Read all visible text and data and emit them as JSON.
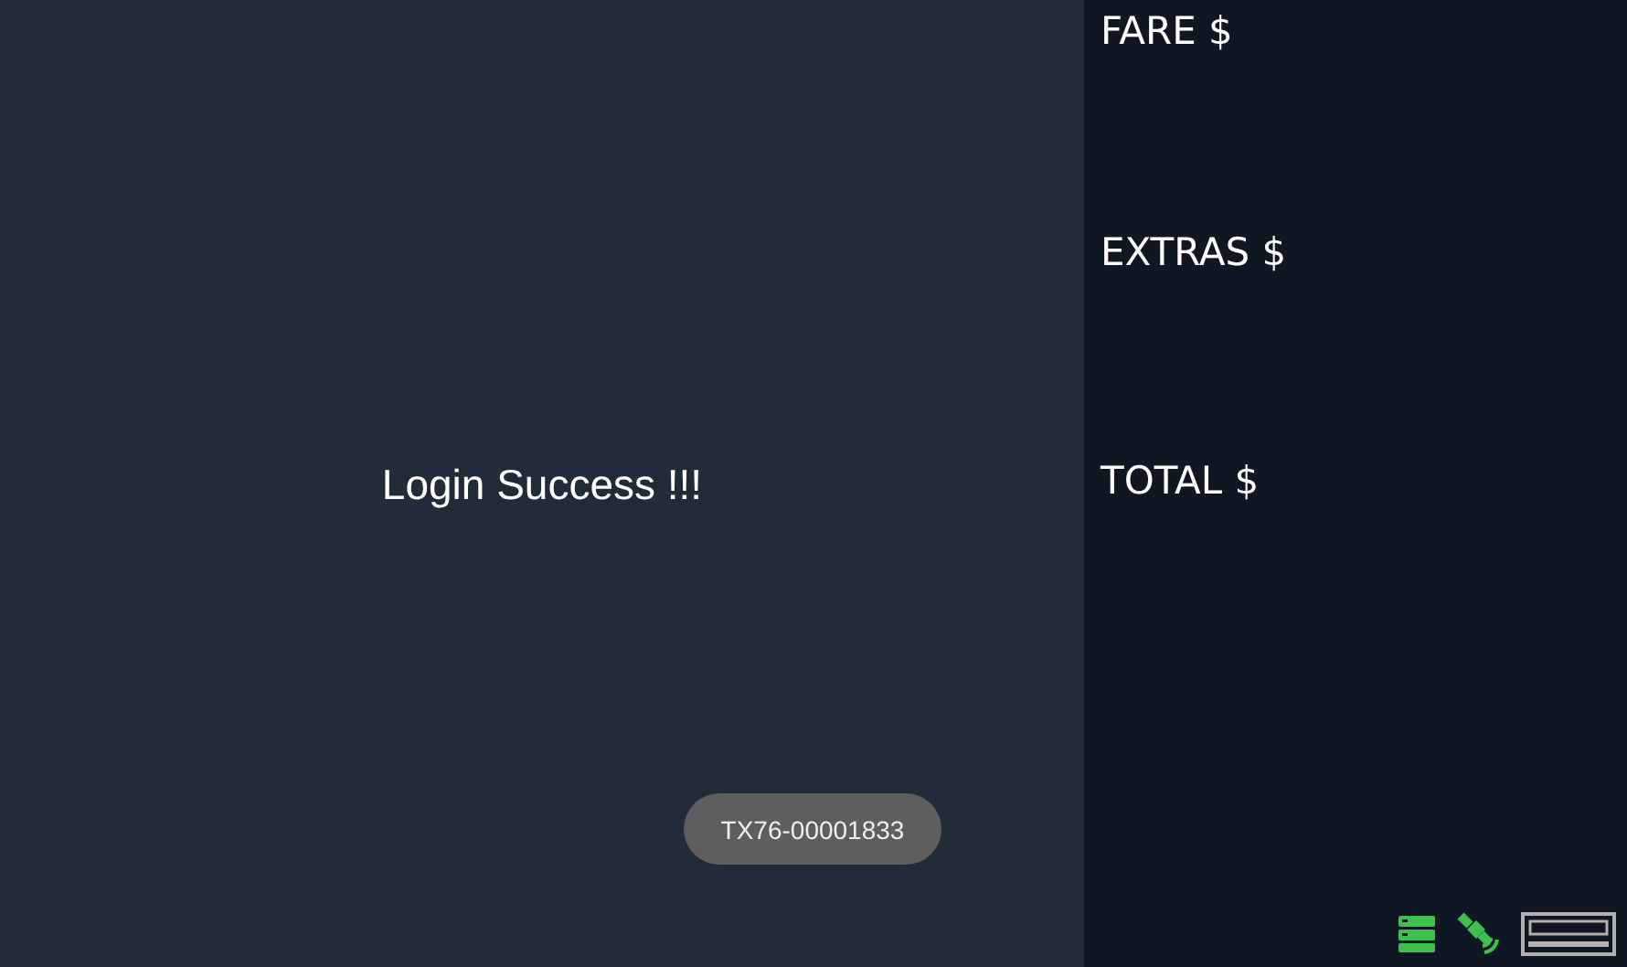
{
  "main": {
    "message": "Login Success !!!"
  },
  "fare_panel": {
    "labels": [
      "FARE $",
      "EXTRAS $",
      "TOTAL $"
    ]
  },
  "toast": {
    "text": "TX76-00001833"
  }
}
